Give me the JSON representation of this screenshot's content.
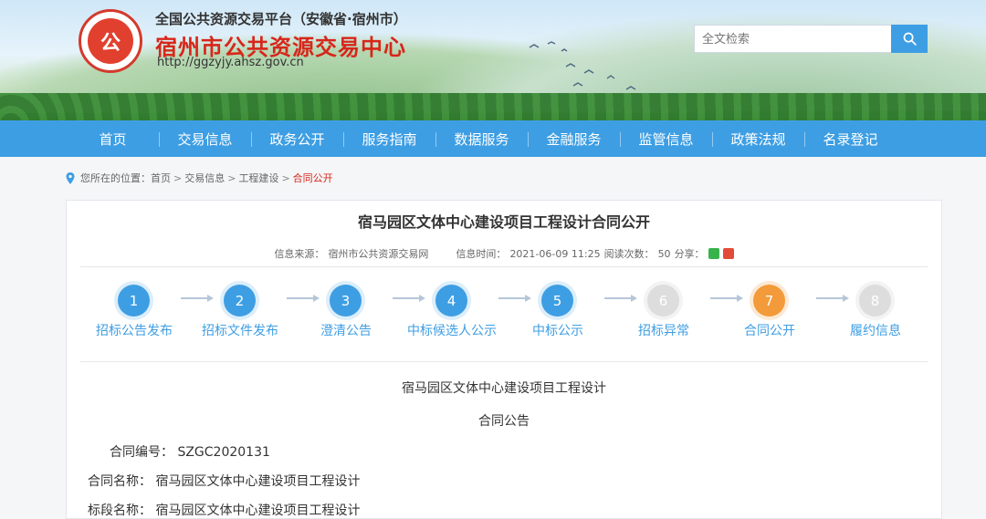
{
  "header": {
    "platform_name": "全国公共资源交易平台（安徽省·宿州市）",
    "site_title": "宿州市公共资源交易中心",
    "url": "http://ggzyjy.ahsz.gov.cn",
    "logo_text": "公"
  },
  "search": {
    "placeholder": "全文检索",
    "icon": "search-icon"
  },
  "nav": {
    "items": [
      "首页",
      "交易信息",
      "政务公开",
      "服务指南",
      "数据服务",
      "金融服务",
      "监管信息",
      "政策法规",
      "名录登记"
    ]
  },
  "breadcrumb": {
    "prefix": "您所在的位置：",
    "items": [
      "首页",
      "交易信息",
      "工程建设",
      "合同公开"
    ],
    "active_index": 3
  },
  "article": {
    "title": "宿马园区文体中心建设项目工程设计合同公开",
    "source_label": "信息来源：",
    "source": "宿州市公共资源交易网",
    "time_label": "信息时间：",
    "time": "2021-06-09 11:25",
    "reads_label": "阅读次数：",
    "reads": "50",
    "share_label": "分享："
  },
  "steps": [
    {
      "num": "1",
      "label": "招标公告发布",
      "state": "done"
    },
    {
      "num": "2",
      "label": "招标文件发布",
      "state": "done"
    },
    {
      "num": "3",
      "label": "澄清公告",
      "state": "done"
    },
    {
      "num": "4",
      "label": "中标候选人公示",
      "state": "done"
    },
    {
      "num": "5",
      "label": "中标公示",
      "state": "done"
    },
    {
      "num": "6",
      "label": "招标异常",
      "state": "disabled"
    },
    {
      "num": "7",
      "label": "合同公开",
      "state": "current"
    },
    {
      "num": "8",
      "label": "履约信息",
      "state": "disabled"
    }
  ],
  "contract": {
    "heading1": "宿马园区文体中心建设项目工程设计",
    "heading2": "合同公告",
    "field1_label": "合同编号：",
    "field1_value": "SZGC2020131",
    "field2_label": "合同名称：",
    "field2_value": "宿马园区文体中心建设项目工程设计",
    "field3_label": "标段名称：",
    "field3_value": "宿马园区文体中心建设项目工程设计"
  },
  "colors": {
    "nav_blue": "#3e9ee3",
    "title_red": "#d7261b",
    "step_done": "#3e9ee3",
    "step_current": "#f39a3a",
    "step_disabled": "#dddddd"
  }
}
